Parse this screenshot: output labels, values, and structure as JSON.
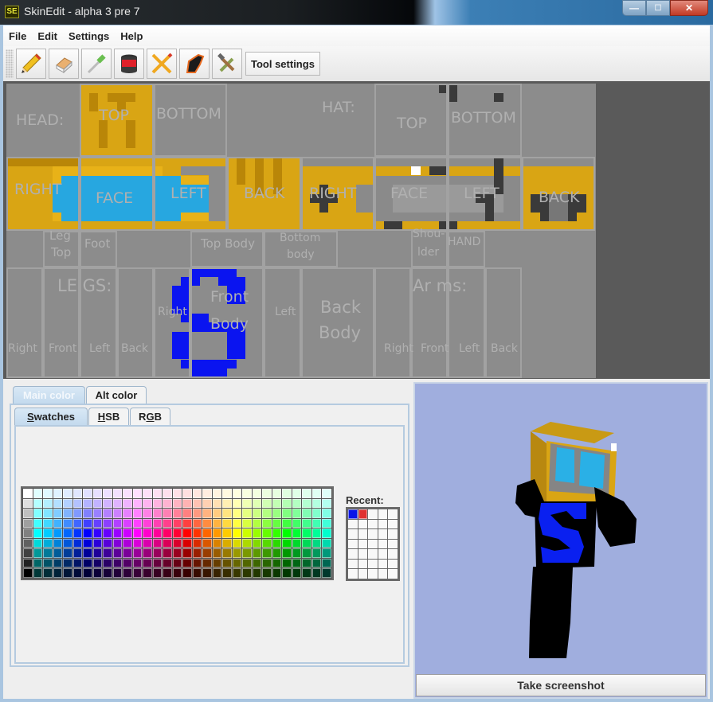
{
  "window": {
    "app_icon_text": "SE",
    "title": "SkinEdit - alpha 3 pre 7",
    "minimize_glyph": "—",
    "maximize_glyph": "☐",
    "close_glyph": "✕"
  },
  "menu": [
    "File",
    "Edit",
    "Settings",
    "Help"
  ],
  "toolbar": {
    "tools": [
      {
        "name": "pencil",
        "icon": "pencil-icon"
      },
      {
        "name": "eraser",
        "icon": "eraser-icon"
      },
      {
        "name": "eyedropper",
        "icon": "eyedropper-icon"
      },
      {
        "name": "paint-bucket",
        "icon": "paint-bucket-icon"
      },
      {
        "name": "line",
        "icon": "cross-pencil-icon"
      },
      {
        "name": "darken",
        "icon": "burn-icon"
      },
      {
        "name": "tools",
        "icon": "hammer-wrench-icon"
      }
    ],
    "tool_settings_label": "Tool settings"
  },
  "skin_map": {
    "section_labels": {
      "head": "HEAD:",
      "hat": "HAT:",
      "legs": "LE GS:",
      "arms": "Ar ms:"
    },
    "head": {
      "top": "TOP",
      "bottom": "BOTTOM",
      "right": "RIGHT",
      "face": "FACE",
      "left": "LEFT",
      "back": "BACK"
    },
    "hat": {
      "top": "TOP",
      "bottom": "BOTTOM",
      "right": "RIGHT",
      "face": "FACE",
      "left": "LEFT",
      "back": "BACK"
    },
    "leg": {
      "top_line1": "Leg",
      "top_line2": "Top",
      "foot": "Foot",
      "right": "Right",
      "front": "Front",
      "left": "Left",
      "back": "Back"
    },
    "body": {
      "top": "Top Body",
      "bottom_line1": "Bottom",
      "bottom_line2": "body",
      "right": "Right",
      "front_line1": "Front",
      "front_line2": "Body",
      "left": "Left",
      "back_line1": "Back",
      "back_line2": "Body"
    },
    "arm": {
      "shoulder_line1": "Shou-",
      "shoulder_line2": "lder",
      "hand": "HAND",
      "right": "Right",
      "front": "Front",
      "left": "Left",
      "back": "Back"
    },
    "colors": {
      "gold": "#d9a514",
      "gold_dark": "#b98608",
      "screen": "#27a7e0",
      "gray_frame": "#7a7a7a",
      "dark": "#3a3a3a",
      "logo_blue": "#0a14f0",
      "white_px": "#ffffff"
    }
  },
  "color_chooser": {
    "outer_tabs": [
      {
        "label": "Main color",
        "active": true
      },
      {
        "label": "Alt color",
        "active": false
      }
    ],
    "inner_tabs": [
      {
        "label": "Swatches",
        "mnemonic_index": 0,
        "active": true
      },
      {
        "label": "HSB",
        "mnemonic_index": 0,
        "active": false
      },
      {
        "label": "RGB",
        "mnemonic_index": 1,
        "active": false
      }
    ],
    "swatch_columns": 31,
    "swatch_rows": 9,
    "recent_label": "Recent:",
    "recent_columns": 5,
    "recent_rows": 7,
    "recent_colors": [
      "#0a14e8",
      "#e03030"
    ]
  },
  "preview": {
    "background": "#a0aede",
    "screenshot_button_label": "Take screenshot"
  }
}
